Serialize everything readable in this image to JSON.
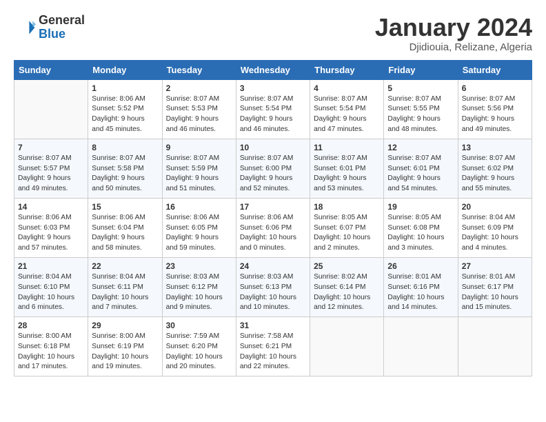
{
  "header": {
    "logo_line1": "General",
    "logo_line2": "Blue",
    "month": "January 2024",
    "location": "Djidiouia, Relizane, Algeria"
  },
  "days_of_week": [
    "Sunday",
    "Monday",
    "Tuesday",
    "Wednesday",
    "Thursday",
    "Friday",
    "Saturday"
  ],
  "weeks": [
    [
      {
        "day": "",
        "info": ""
      },
      {
        "day": "1",
        "info": "Sunrise: 8:06 AM\nSunset: 5:52 PM\nDaylight: 9 hours\nand 45 minutes."
      },
      {
        "day": "2",
        "info": "Sunrise: 8:07 AM\nSunset: 5:53 PM\nDaylight: 9 hours\nand 46 minutes."
      },
      {
        "day": "3",
        "info": "Sunrise: 8:07 AM\nSunset: 5:54 PM\nDaylight: 9 hours\nand 46 minutes."
      },
      {
        "day": "4",
        "info": "Sunrise: 8:07 AM\nSunset: 5:54 PM\nDaylight: 9 hours\nand 47 minutes."
      },
      {
        "day": "5",
        "info": "Sunrise: 8:07 AM\nSunset: 5:55 PM\nDaylight: 9 hours\nand 48 minutes."
      },
      {
        "day": "6",
        "info": "Sunrise: 8:07 AM\nSunset: 5:56 PM\nDaylight: 9 hours\nand 49 minutes."
      }
    ],
    [
      {
        "day": "7",
        "info": "Sunrise: 8:07 AM\nSunset: 5:57 PM\nDaylight: 9 hours\nand 49 minutes."
      },
      {
        "day": "8",
        "info": "Sunrise: 8:07 AM\nSunset: 5:58 PM\nDaylight: 9 hours\nand 50 minutes."
      },
      {
        "day": "9",
        "info": "Sunrise: 8:07 AM\nSunset: 5:59 PM\nDaylight: 9 hours\nand 51 minutes."
      },
      {
        "day": "10",
        "info": "Sunrise: 8:07 AM\nSunset: 6:00 PM\nDaylight: 9 hours\nand 52 minutes."
      },
      {
        "day": "11",
        "info": "Sunrise: 8:07 AM\nSunset: 6:01 PM\nDaylight: 9 hours\nand 53 minutes."
      },
      {
        "day": "12",
        "info": "Sunrise: 8:07 AM\nSunset: 6:01 PM\nDaylight: 9 hours\nand 54 minutes."
      },
      {
        "day": "13",
        "info": "Sunrise: 8:07 AM\nSunset: 6:02 PM\nDaylight: 9 hours\nand 55 minutes."
      }
    ],
    [
      {
        "day": "14",
        "info": "Sunrise: 8:06 AM\nSunset: 6:03 PM\nDaylight: 9 hours\nand 57 minutes."
      },
      {
        "day": "15",
        "info": "Sunrise: 8:06 AM\nSunset: 6:04 PM\nDaylight: 9 hours\nand 58 minutes."
      },
      {
        "day": "16",
        "info": "Sunrise: 8:06 AM\nSunset: 6:05 PM\nDaylight: 9 hours\nand 59 minutes."
      },
      {
        "day": "17",
        "info": "Sunrise: 8:06 AM\nSunset: 6:06 PM\nDaylight: 10 hours\nand 0 minutes."
      },
      {
        "day": "18",
        "info": "Sunrise: 8:05 AM\nSunset: 6:07 PM\nDaylight: 10 hours\nand 2 minutes."
      },
      {
        "day": "19",
        "info": "Sunrise: 8:05 AM\nSunset: 6:08 PM\nDaylight: 10 hours\nand 3 minutes."
      },
      {
        "day": "20",
        "info": "Sunrise: 8:04 AM\nSunset: 6:09 PM\nDaylight: 10 hours\nand 4 minutes."
      }
    ],
    [
      {
        "day": "21",
        "info": "Sunrise: 8:04 AM\nSunset: 6:10 PM\nDaylight: 10 hours\nand 6 minutes."
      },
      {
        "day": "22",
        "info": "Sunrise: 8:04 AM\nSunset: 6:11 PM\nDaylight: 10 hours\nand 7 minutes."
      },
      {
        "day": "23",
        "info": "Sunrise: 8:03 AM\nSunset: 6:12 PM\nDaylight: 10 hours\nand 9 minutes."
      },
      {
        "day": "24",
        "info": "Sunrise: 8:03 AM\nSunset: 6:13 PM\nDaylight: 10 hours\nand 10 minutes."
      },
      {
        "day": "25",
        "info": "Sunrise: 8:02 AM\nSunset: 6:14 PM\nDaylight: 10 hours\nand 12 minutes."
      },
      {
        "day": "26",
        "info": "Sunrise: 8:01 AM\nSunset: 6:16 PM\nDaylight: 10 hours\nand 14 minutes."
      },
      {
        "day": "27",
        "info": "Sunrise: 8:01 AM\nSunset: 6:17 PM\nDaylight: 10 hours\nand 15 minutes."
      }
    ],
    [
      {
        "day": "28",
        "info": "Sunrise: 8:00 AM\nSunset: 6:18 PM\nDaylight: 10 hours\nand 17 minutes."
      },
      {
        "day": "29",
        "info": "Sunrise: 8:00 AM\nSunset: 6:19 PM\nDaylight: 10 hours\nand 19 minutes."
      },
      {
        "day": "30",
        "info": "Sunrise: 7:59 AM\nSunset: 6:20 PM\nDaylight: 10 hours\nand 20 minutes."
      },
      {
        "day": "31",
        "info": "Sunrise: 7:58 AM\nSunset: 6:21 PM\nDaylight: 10 hours\nand 22 minutes."
      },
      {
        "day": "",
        "info": ""
      },
      {
        "day": "",
        "info": ""
      },
      {
        "day": "",
        "info": ""
      }
    ]
  ]
}
